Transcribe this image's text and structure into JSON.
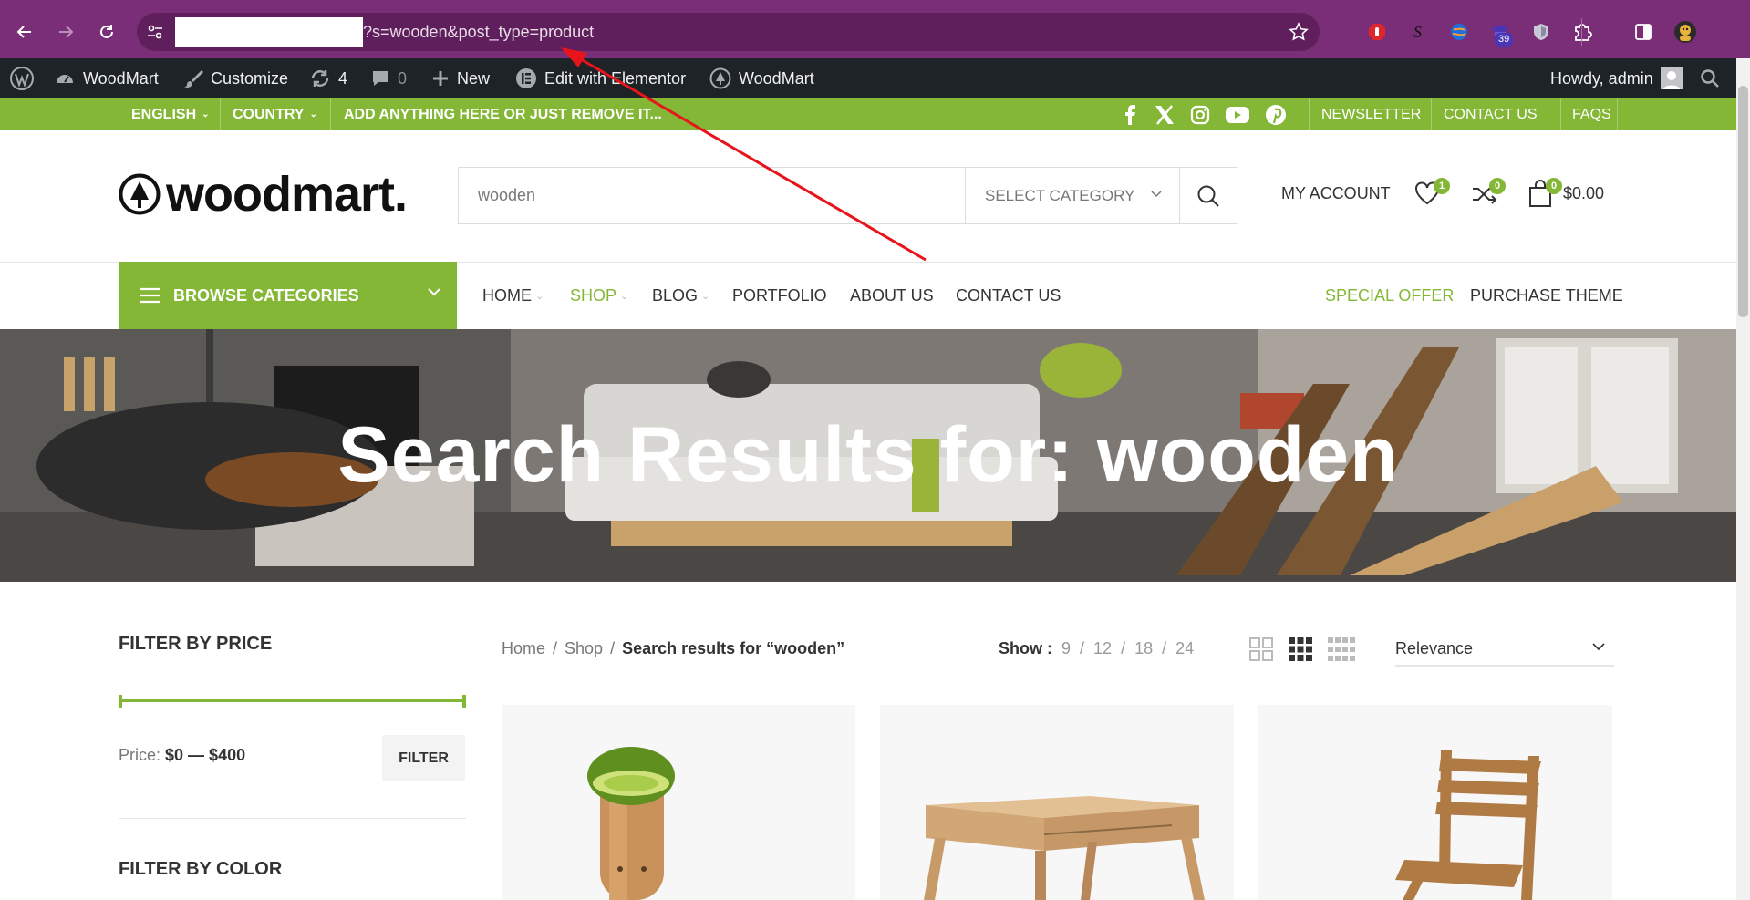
{
  "browser": {
    "url_visible": "?s=wooden&post_type=product",
    "extension_badge": "39"
  },
  "adminbar": {
    "site_name": "WoodMart",
    "customize": "Customize",
    "updates": "4",
    "comments": "0",
    "new": "New",
    "elementor": "Edit with Elementor",
    "theme": "WoodMart",
    "howdy": "Howdy, admin"
  },
  "topbar": {
    "language": "ENGLISH",
    "country": "COUNTRY",
    "promo": "ADD ANYTHING HERE OR JUST REMOVE IT...",
    "links": [
      "NEWSLETTER",
      "CONTACT US",
      "FAQS"
    ]
  },
  "header": {
    "logo": "woodmart.",
    "search_value": "wooden",
    "search_category": "SELECT CATEGORY",
    "my_account": "MY ACCOUNT",
    "wishlist_count": "1",
    "compare_count": "0",
    "cart_count": "0",
    "cart_total": "$0.00"
  },
  "nav": {
    "browse": "BROWSE CATEGORIES",
    "items": [
      "HOME",
      "SHOP",
      "BLOG",
      "PORTFOLIO",
      "ABOUT US",
      "CONTACT US"
    ],
    "special_offer": "SPECIAL OFFER",
    "purchase": "PURCHASE THEME"
  },
  "hero": {
    "title": "Search Results for: wooden"
  },
  "sidebar": {
    "filter_price_title": "FILTER BY PRICE",
    "price_label": "Price:",
    "price_range": "$0 — $400",
    "filter_button": "FILTER",
    "filter_color_title": "FILTER BY COLOR"
  },
  "toolbar": {
    "breadcrumb": [
      "Home",
      "Shop",
      "Search results for “wooden”"
    ],
    "show_label": "Show :",
    "show_options": [
      "9",
      "12",
      "18",
      "24"
    ],
    "sort_value": "Relevance"
  },
  "colors": {
    "accent": "#83b735",
    "chrome": "#7a2e77",
    "adminbar": "#1d2327"
  }
}
